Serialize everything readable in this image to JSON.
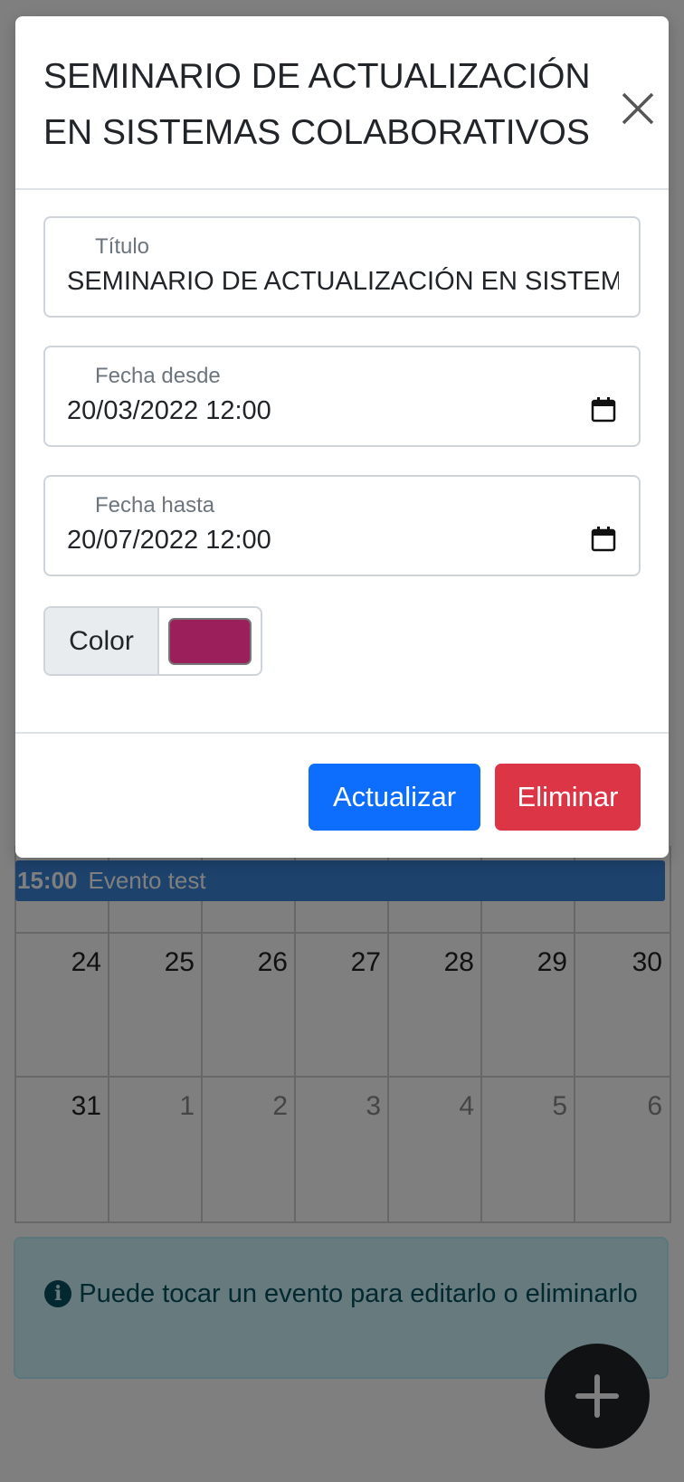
{
  "calendar": {
    "event": {
      "time": "15:00",
      "title": "Evento test",
      "color": "#3a84d9"
    },
    "week_rows": [
      [
        {
          "day": "24",
          "other_month": false
        },
        {
          "day": "25",
          "other_month": false
        },
        {
          "day": "26",
          "other_month": false
        },
        {
          "day": "27",
          "other_month": false
        },
        {
          "day": "28",
          "other_month": false
        },
        {
          "day": "29",
          "other_month": false
        },
        {
          "day": "30",
          "other_month": false
        }
      ],
      [
        {
          "day": "31",
          "other_month": false
        },
        {
          "day": "1",
          "other_month": true
        },
        {
          "day": "2",
          "other_month": true
        },
        {
          "day": "3",
          "other_month": true
        },
        {
          "day": "4",
          "other_month": true
        },
        {
          "day": "5",
          "other_month": true
        },
        {
          "day": "6",
          "other_month": true
        }
      ]
    ],
    "info_text": "Puede tocar un evento para editarlo o eliminarlo",
    "info_icon": "info-circle-icon",
    "fab_icon": "plus-icon"
  },
  "modal": {
    "title": "SEMINARIO DE ACTUALIZACIÓN EN SISTEMAS COLABORATIVOS",
    "close_icon": "close-icon",
    "fields": {
      "title": {
        "label": "Título",
        "value": "SEMINARIO DE ACTUALIZACIÓN EN SISTEMAS COLABORATIVOS"
      },
      "date_from": {
        "label": "Fecha desde",
        "value": "20/03/2022 12:00",
        "icon": "calendar-icon"
      },
      "date_to": {
        "label": "Fecha hasta",
        "value": "20/07/2022 12:00",
        "icon": "calendar-icon"
      }
    },
    "color": {
      "label": "Color",
      "value": "#9b1f5a"
    },
    "buttons": {
      "update": {
        "label": "Actualizar",
        "color": "#0d6efd"
      },
      "delete": {
        "label": "Eliminar",
        "color": "#dc3545"
      }
    }
  }
}
